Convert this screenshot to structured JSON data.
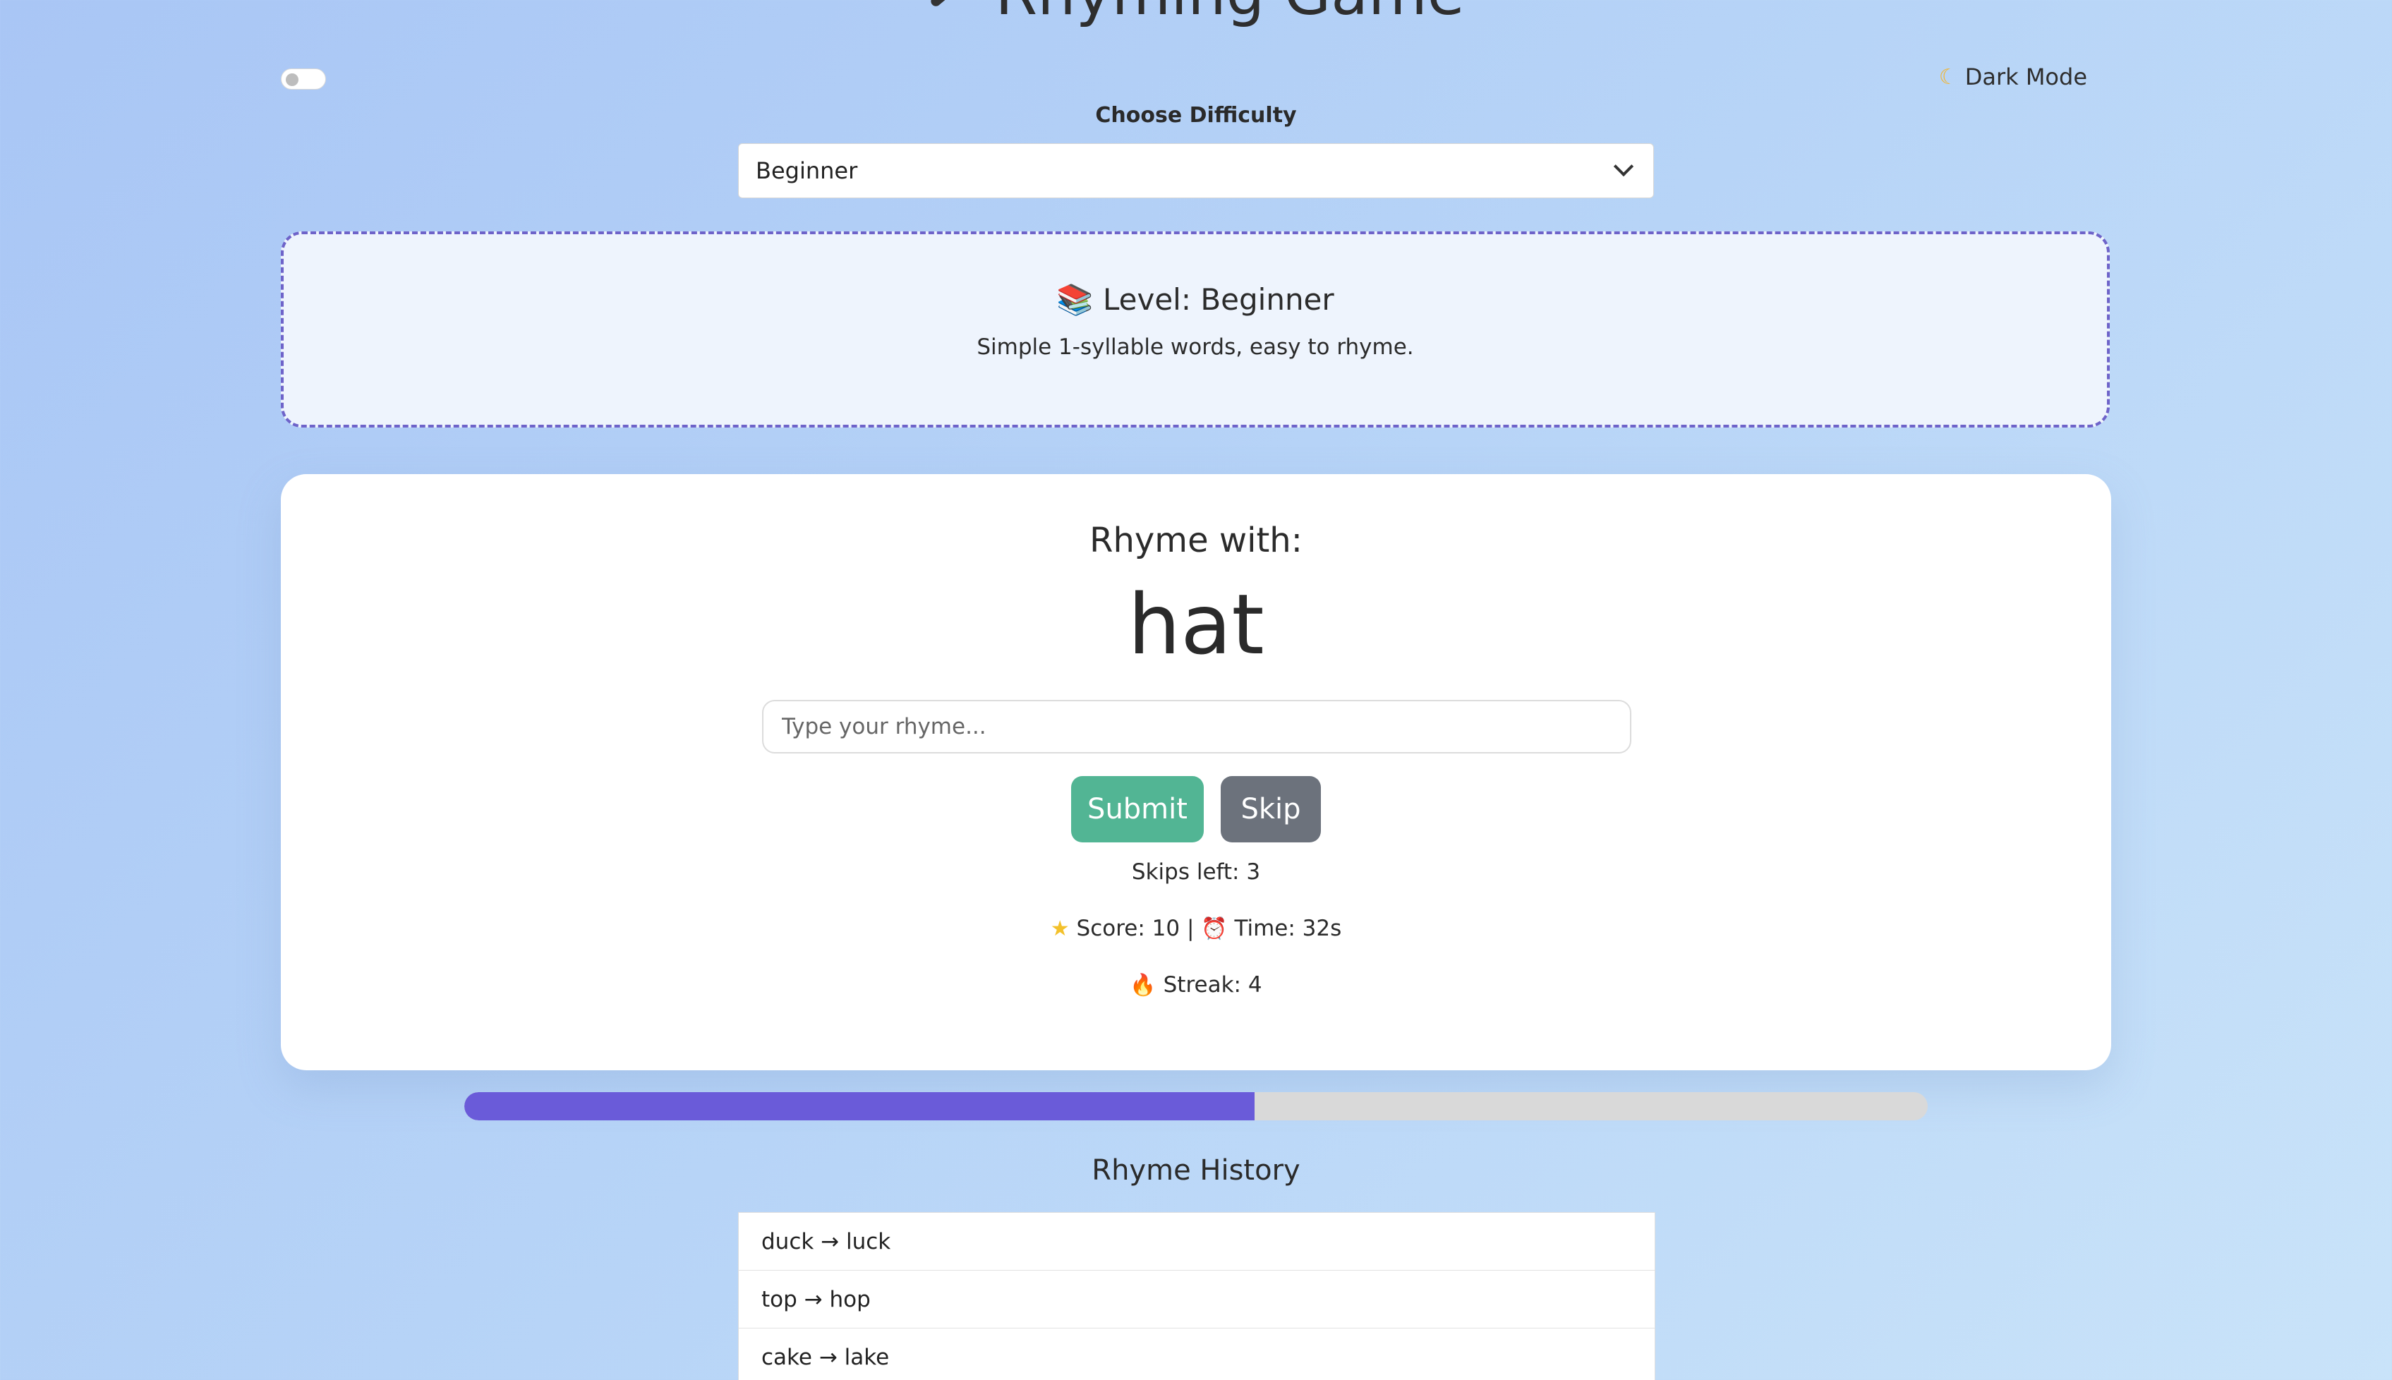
{
  "header": {
    "title": "Rhyming Game",
    "dark_mode_label": "Dark Mode",
    "dark_mode_on": false
  },
  "difficulty": {
    "label": "Choose Difficulty",
    "selected": "Beginner"
  },
  "level": {
    "title": "📚 Level: Beginner",
    "description": "Simple 1-syllable words, easy to rhyme."
  },
  "game": {
    "prompt": "Rhyme with:",
    "word": "hat",
    "input_placeholder": "Type your rhyme...",
    "input_value": "",
    "submit_label": "Submit",
    "skip_label": "Skip",
    "skips_text": "Skips left: 3",
    "score_text": "Score: 10 | ",
    "time_text": "Time: 32s",
    "streak_text": "Streak: 4"
  },
  "progress": {
    "fraction": 0.54,
    "fill_color": "#6a5bd9"
  },
  "history": {
    "title": "Rhyme History",
    "items": [
      {
        "label": "duck → luck"
      },
      {
        "label": "top → hop"
      },
      {
        "label": "cake → lake"
      }
    ]
  },
  "colors": {
    "accent": "#6a5bd9",
    "submit": "#52b594",
    "skip": "#6c727c",
    "level_border": "#6e63c9"
  },
  "icons": {
    "title_icon": "magic-wand-icon",
    "dark_mode_icon": "moon-icon",
    "score_icon": "star-icon",
    "time_icon": "alarm-clock-icon",
    "streak_icon": "fire-icon"
  }
}
